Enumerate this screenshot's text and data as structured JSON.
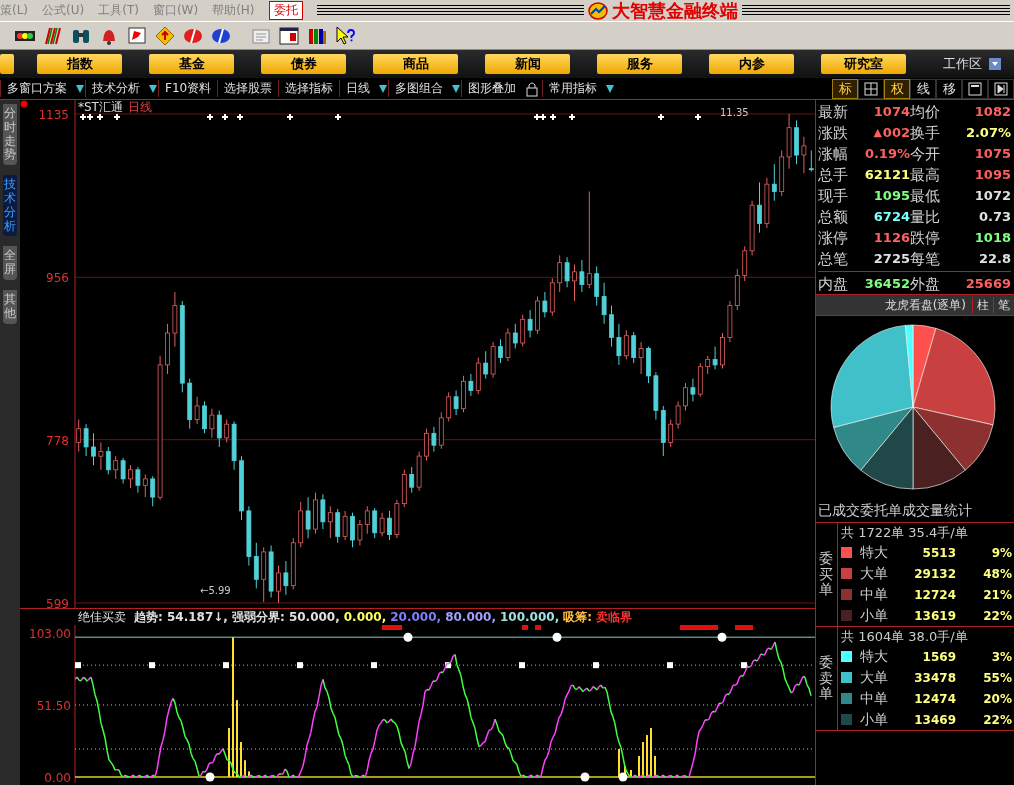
{
  "menu": [
    {
      "kind": "menu",
      "label": "策(L)"
    },
    {
      "kind": "menu",
      "label": "公式(U)"
    },
    {
      "kind": "menu",
      "label": "工具(T)"
    },
    {
      "kind": "menu",
      "label": "窗口(W)"
    },
    {
      "kind": "menu",
      "label": "帮助(H)"
    },
    {
      "kind": "button",
      "label": "委托"
    }
  ],
  "window": {
    "title": "大智慧金融终端"
  },
  "nav": [
    "指数",
    "基金",
    "债券",
    "商品",
    "新闻",
    "服务",
    "内参",
    "研究室"
  ],
  "workspace": {
    "label": "工作区"
  },
  "tools": [
    {
      "kind": "button",
      "label": "多窗口方案",
      "dropdown": true
    },
    {
      "kind": "button",
      "label": "技术分析",
      "dropdown": true
    },
    {
      "kind": "button",
      "label": "F10资料",
      "dropdown": false
    },
    {
      "kind": "button",
      "label": "选择股票",
      "dropdown": false
    },
    {
      "kind": "button",
      "label": "选择指标",
      "dropdown": false
    },
    {
      "kind": "button",
      "label": "日线",
      "dropdown": true
    },
    {
      "kind": "button",
      "label": "多图组合",
      "dropdown": true
    },
    {
      "kind": "button",
      "label": "图形叠加",
      "dropdown": false
    },
    {
      "kind": "lock"
    },
    {
      "kind": "button",
      "label": "常用指标",
      "dropdown": true
    }
  ],
  "right_tools": [
    {
      "kind": "text",
      "label": "标",
      "selected": true
    },
    {
      "kind": "plus-box",
      "selected": false
    },
    {
      "kind": "text",
      "label": "权",
      "selected": true
    },
    {
      "kind": "text",
      "label": "线",
      "selected": false
    },
    {
      "kind": "text",
      "label": "移",
      "selected": false
    },
    {
      "kind": "restore",
      "selected": false
    },
    {
      "kind": "next",
      "selected": false
    }
  ],
  "side_tabs": [
    {
      "label": "分时走势",
      "selected": false
    },
    {
      "label": "技术分析",
      "selected": true
    },
    {
      "label": "全屏",
      "selected": false
    },
    {
      "label": "其他",
      "selected": false
    }
  ],
  "price_chart": {
    "stock": "*ST汇通",
    "period": "日线",
    "low_note": "←5.99",
    "high_note": "11.35",
    "chart_data": {
      "type": "candlestick",
      "ylim": [
        599,
        1135
      ],
      "yticks": [
        599,
        778,
        956,
        1135
      ],
      "ohlc": [
        [
          775,
          800,
          765,
          790
        ],
        [
          790,
          795,
          760,
          770
        ],
        [
          770,
          785,
          750,
          760
        ],
        [
          760,
          775,
          745,
          765
        ],
        [
          765,
          770,
          740,
          745
        ],
        [
          745,
          760,
          735,
          755
        ],
        [
          755,
          758,
          730,
          735
        ],
        [
          735,
          750,
          725,
          745
        ],
        [
          745,
          748,
          720,
          728
        ],
        [
          728,
          740,
          715,
          735
        ],
        [
          735,
          738,
          705,
          715
        ],
        [
          715,
          870,
          712,
          860
        ],
        [
          860,
          905,
          850,
          895
        ],
        [
          895,
          940,
          880,
          925
        ],
        [
          925,
          930,
          830,
          840
        ],
        [
          840,
          845,
          790,
          800
        ],
        [
          800,
          825,
          795,
          815
        ],
        [
          815,
          820,
          785,
          790
        ],
        [
          790,
          812,
          780,
          805
        ],
        [
          805,
          810,
          770,
          780
        ],
        [
          780,
          800,
          775,
          795
        ],
        [
          795,
          798,
          745,
          755
        ],
        [
          755,
          760,
          690,
          700
        ],
        [
          700,
          705,
          640,
          650
        ],
        [
          650,
          665,
          615,
          625
        ],
        [
          625,
          660,
          600,
          655
        ],
        [
          655,
          662,
          605,
          612
        ],
        [
          612,
          640,
          599,
          632
        ],
        [
          632,
          645,
          608,
          618
        ],
        [
          618,
          670,
          614,
          665
        ],
        [
          665,
          710,
          660,
          700
        ],
        [
          700,
          715,
          670,
          680
        ],
        [
          680,
          720,
          675,
          712
        ],
        [
          712,
          718,
          680,
          688
        ],
        [
          688,
          705,
          670,
          698
        ],
        [
          698,
          702,
          665,
          672
        ],
        [
          672,
          700,
          668,
          694
        ],
        [
          694,
          698,
          660,
          668
        ],
        [
          668,
          690,
          662,
          685
        ],
        [
          685,
          705,
          675,
          700
        ],
        [
          700,
          703,
          670,
          676
        ],
        [
          676,
          698,
          672,
          692
        ],
        [
          692,
          700,
          668,
          674
        ],
        [
          674,
          712,
          670,
          708
        ],
        [
          708,
          745,
          704,
          740
        ],
        [
          740,
          748,
          720,
          726
        ],
        [
          726,
          765,
          722,
          760
        ],
        [
          760,
          790,
          755,
          785
        ],
        [
          785,
          792,
          765,
          772
        ],
        [
          772,
          808,
          768,
          802
        ],
        [
          802,
          830,
          798,
          825
        ],
        [
          825,
          832,
          805,
          812
        ],
        [
          812,
          848,
          808,
          842
        ],
        [
          842,
          850,
          826,
          832
        ],
        [
          832,
          868,
          828,
          862
        ],
        [
          862,
          875,
          845,
          850
        ],
        [
          850,
          885,
          846,
          880
        ],
        [
          880,
          888,
          862,
          868
        ],
        [
          868,
          900,
          864,
          895
        ],
        [
          895,
          905,
          878,
          884
        ],
        [
          884,
          915,
          880,
          910
        ],
        [
          910,
          920,
          890,
          898
        ],
        [
          898,
          935,
          894,
          930
        ],
        [
          930,
          940,
          912,
          918
        ],
        [
          918,
          955,
          914,
          950
        ],
        [
          950,
          980,
          940,
          972
        ],
        [
          972,
          978,
          945,
          952
        ],
        [
          952,
          970,
          930,
          962
        ],
        [
          962,
          975,
          940,
          948
        ],
        [
          948,
          1050,
          944,
          960
        ],
        [
          960,
          968,
          925,
          935
        ],
        [
          935,
          950,
          905,
          915
        ],
        [
          915,
          925,
          880,
          890
        ],
        [
          890,
          905,
          860,
          870
        ],
        [
          870,
          898,
          866,
          892
        ],
        [
          892,
          896,
          862,
          868
        ],
        [
          868,
          885,
          850,
          878
        ],
        [
          878,
          880,
          840,
          848
        ],
        [
          848,
          852,
          800,
          810
        ],
        [
          810,
          815,
          760,
          775
        ],
        [
          775,
          800,
          770,
          795
        ],
        [
          795,
          820,
          790,
          815
        ],
        [
          815,
          840,
          810,
          835
        ],
        [
          835,
          845,
          820,
          828
        ],
        [
          828,
          862,
          825,
          858
        ],
        [
          858,
          870,
          850,
          866
        ],
        [
          866,
          880,
          855,
          860
        ],
        [
          860,
          895,
          856,
          890
        ],
        [
          890,
          930,
          885,
          925
        ],
        [
          925,
          965,
          920,
          958
        ],
        [
          958,
          990,
          952,
          985
        ],
        [
          985,
          1040,
          980,
          1035
        ],
        [
          1035,
          1060,
          1005,
          1015
        ],
        [
          1015,
          1065,
          1010,
          1058
        ],
        [
          1058,
          1080,
          1040,
          1050
        ],
        [
          1050,
          1095,
          1045,
          1088
        ],
        [
          1088,
          1135,
          1075,
          1120
        ],
        [
          1120,
          1128,
          1080,
          1090
        ],
        [
          1090,
          1110,
          1070,
          1100
        ],
        [
          1075,
          1095,
          1072,
          1074
        ]
      ]
    }
  },
  "indicator": {
    "title": "绝佳买卖",
    "legend": [
      {
        "text": "趋势: 54.187↓,",
        "color": "#e0e0e0"
      },
      {
        "text": "强弱分界: 50.000,",
        "color": "#e0e0e0"
      },
      {
        "text": "0.000,",
        "color": "#ffff60"
      },
      {
        "text": "20.000,",
        "color": "#8080ff"
      },
      {
        "text": "80.000,",
        "color": "#a0a0ff"
      },
      {
        "text": "100.000,",
        "color": "#a0e0e0"
      },
      {
        "text": "吸筹:",
        "color": "#ffc040"
      },
      {
        "text": "卖临界",
        "color": "#ff3030"
      }
    ],
    "axis_labels": [
      "103.00",
      "51.50",
      "0.00"
    ]
  },
  "quote": [
    {
      "label": "最新",
      "value": "1074",
      "color": "#ff6060"
    },
    {
      "label": "均价",
      "value": "1082",
      "color": "#ff6060"
    },
    {
      "label": "涨跌",
      "value": "002",
      "color": "#ff6060",
      "arrow": "▲"
    },
    {
      "label": "换手",
      "value": "2.07%",
      "color": "#ffff80"
    },
    {
      "label": "涨幅",
      "value": "0.19%",
      "color": "#ff6060"
    },
    {
      "label": "今开",
      "value": "1075",
      "color": "#ff6060"
    },
    {
      "label": "总手",
      "value": "62121",
      "color": "#ffff80"
    },
    {
      "label": "最高",
      "value": "1095",
      "color": "#ff6060"
    },
    {
      "label": "现手",
      "value": "1095",
      "color": "#80ff80"
    },
    {
      "label": "最低",
      "value": "1072",
      "color": "#e0e0e0"
    },
    {
      "label": "总额",
      "value": "6724",
      "color": "#80ffff"
    },
    {
      "label": "量比",
      "value": "0.73",
      "color": "#e0e0e0"
    },
    {
      "label": "涨停",
      "value": "1126",
      "color": "#ff6060"
    },
    {
      "label": "跌停",
      "value": "1018",
      "color": "#80ff80"
    },
    {
      "label": "总笔",
      "value": "2725",
      "color": "#e0e0e0"
    },
    {
      "label": "每笔",
      "value": "22.8",
      "color": "#e0e0e0"
    }
  ],
  "inout": [
    {
      "label": "内盘",
      "value": "36452",
      "color": "#80ff80"
    },
    {
      "label": "外盘",
      "value": "25669",
      "color": "#ff6060"
    }
  ],
  "dragon": {
    "title": "龙虎看盘(逐单)",
    "tabs": [
      "柱",
      "笔"
    ],
    "chart_data": {
      "type": "pie",
      "values": [
        4.5,
        24,
        10.5,
        11,
        11,
        10,
        27.5,
        1.5
      ]
    }
  },
  "stats": {
    "title": "已成交委托单成交量统计",
    "groups": [
      {
        "side": "委买单",
        "summary": "共 1722单 35.4手/单",
        "rows": [
          {
            "name": "特大",
            "volume": "5513",
            "percent": "9%",
            "color": "#ff5050"
          },
          {
            "name": "大单",
            "volume": "29132",
            "percent": "48%",
            "color": "#c84040"
          },
          {
            "name": "中单",
            "volume": "12724",
            "percent": "21%",
            "color": "#8c3030"
          },
          {
            "name": "小单",
            "volume": "13619",
            "percent": "22%",
            "color": "#4a2020"
          }
        ]
      },
      {
        "side": "委卖单",
        "summary": "共 1604单 38.0手/单",
        "rows": [
          {
            "name": "特大",
            "volume": "1569",
            "percent": "3%",
            "color": "#50ffff"
          },
          {
            "name": "大单",
            "volume": "33478",
            "percent": "55%",
            "color": "#40c0c8"
          },
          {
            "name": "中单",
            "volume": "12474",
            "percent": "20%",
            "color": "#308888"
          },
          {
            "name": "小单",
            "volume": "13469",
            "percent": "22%",
            "color": "#204848"
          }
        ]
      }
    ]
  }
}
